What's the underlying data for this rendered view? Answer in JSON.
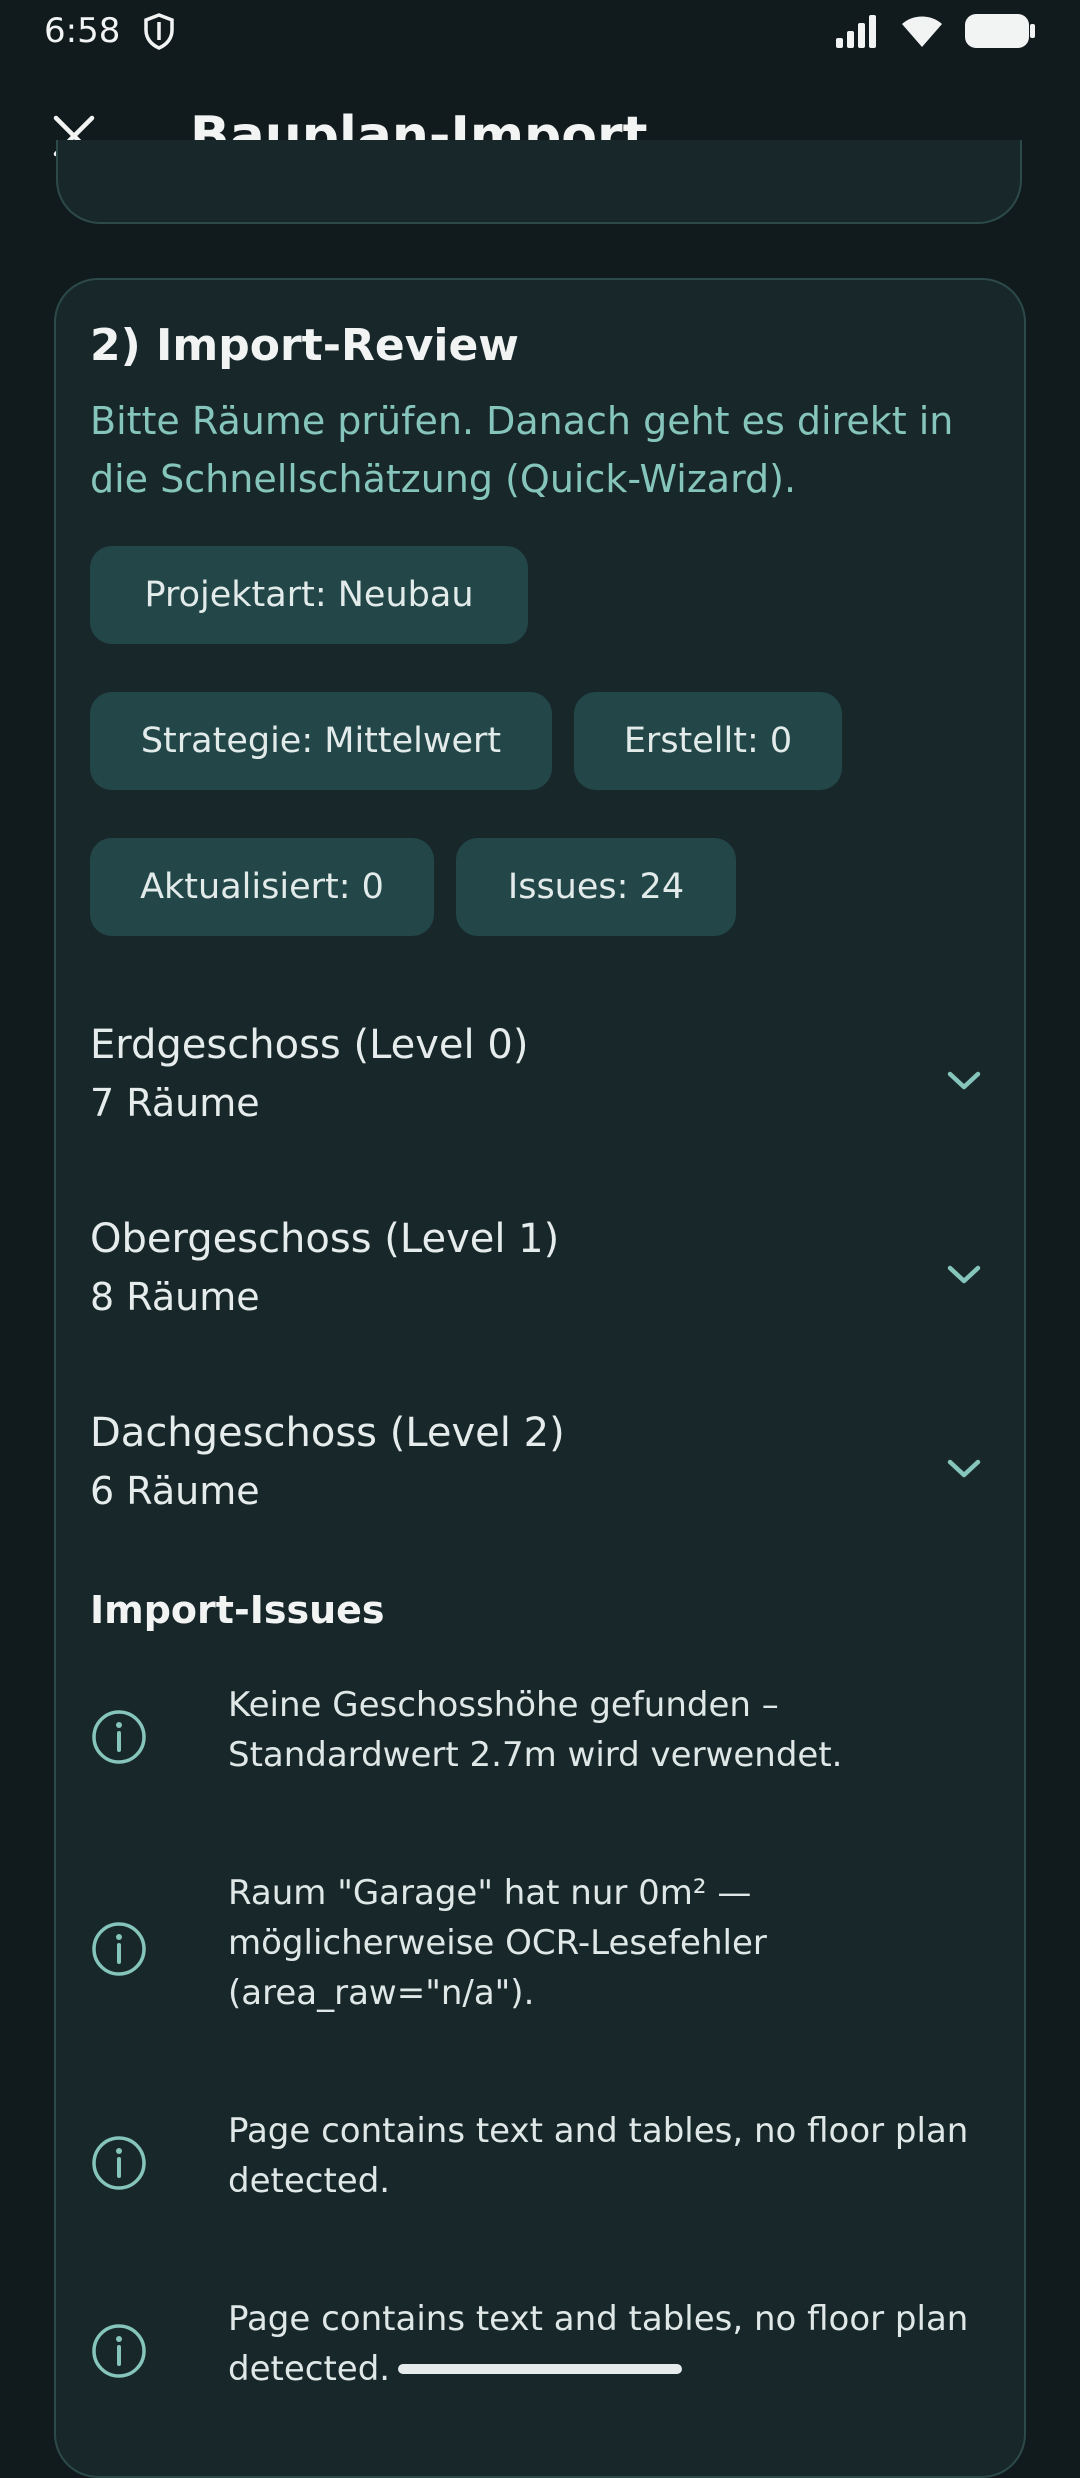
{
  "status_bar": {
    "time": "6:58",
    "icons": [
      "shield-icon",
      "signal-icon",
      "wifi-icon",
      "battery-icon"
    ]
  },
  "header": {
    "title": "Bauplan-Import",
    "close_icon": "close-icon"
  },
  "review": {
    "title": "2) Import-Review",
    "subtitle": "Bitte Räume prüfen. Danach geht es direkt in die Schnellschätzung (Quick-Wizard).",
    "chips": {
      "project_type": "Projektart: Neubau",
      "strategy": "Strategie: Mittelwert",
      "created": "Erstellt: 0",
      "updated": "Aktualisiert: 0",
      "issues": "Issues: 24"
    },
    "levels": [
      {
        "name": "Erdgeschoss (Level 0)",
        "count": "7 Räume"
      },
      {
        "name": "Obergeschoss (Level 1)",
        "count": "8 Räume"
      },
      {
        "name": "Dachgeschoss (Level 2)",
        "count": "6 Räume"
      }
    ],
    "issues_heading": "Import-Issues",
    "issues": [
      {
        "text": "Keine Geschosshöhe gefunden – Standardwert 2.7m wird verwendet."
      },
      {
        "text": "Raum \"Garage\" hat nur 0m² — möglicherweise OCR-Lesefehler (area_raw=\"n/a\")."
      },
      {
        "text": "Page contains text and tables, no floor plan detected."
      },
      {
        "text": "Page contains text and tables, no floor plan detected."
      }
    ]
  },
  "colors": {
    "background": "#111a1d",
    "card": "#18282a",
    "chip": "#234748",
    "accent": "#86c5bb"
  }
}
